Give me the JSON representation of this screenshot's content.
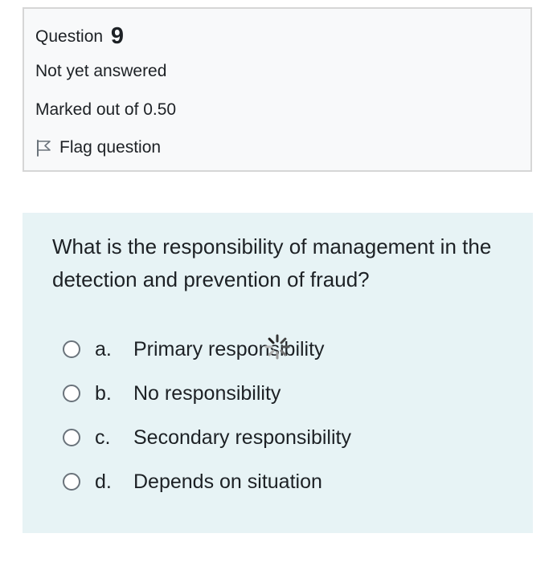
{
  "info": {
    "question_label": "Question",
    "question_number": "9",
    "state": "Not yet answered",
    "grade": "Marked out of 0.50",
    "flag_label": "Flag question"
  },
  "question": {
    "text": "What is the responsibility of management in the detection and prevention of fraud?",
    "answers": [
      {
        "letter": "a.",
        "text": "Primary responsibility"
      },
      {
        "letter": "b.",
        "text": "No responsibility"
      },
      {
        "letter": "c.",
        "text": "Secondary responsibility"
      },
      {
        "letter": "d.",
        "text": "Depends on situation"
      }
    ]
  },
  "icons": {
    "flag": "flag-icon",
    "loading": "loading-spinner-icon"
  },
  "colors": {
    "info_background": "#f8f9fa",
    "question_background": "#e7f3f5",
    "border": "#d6d6d6",
    "text": "#1d2125"
  }
}
